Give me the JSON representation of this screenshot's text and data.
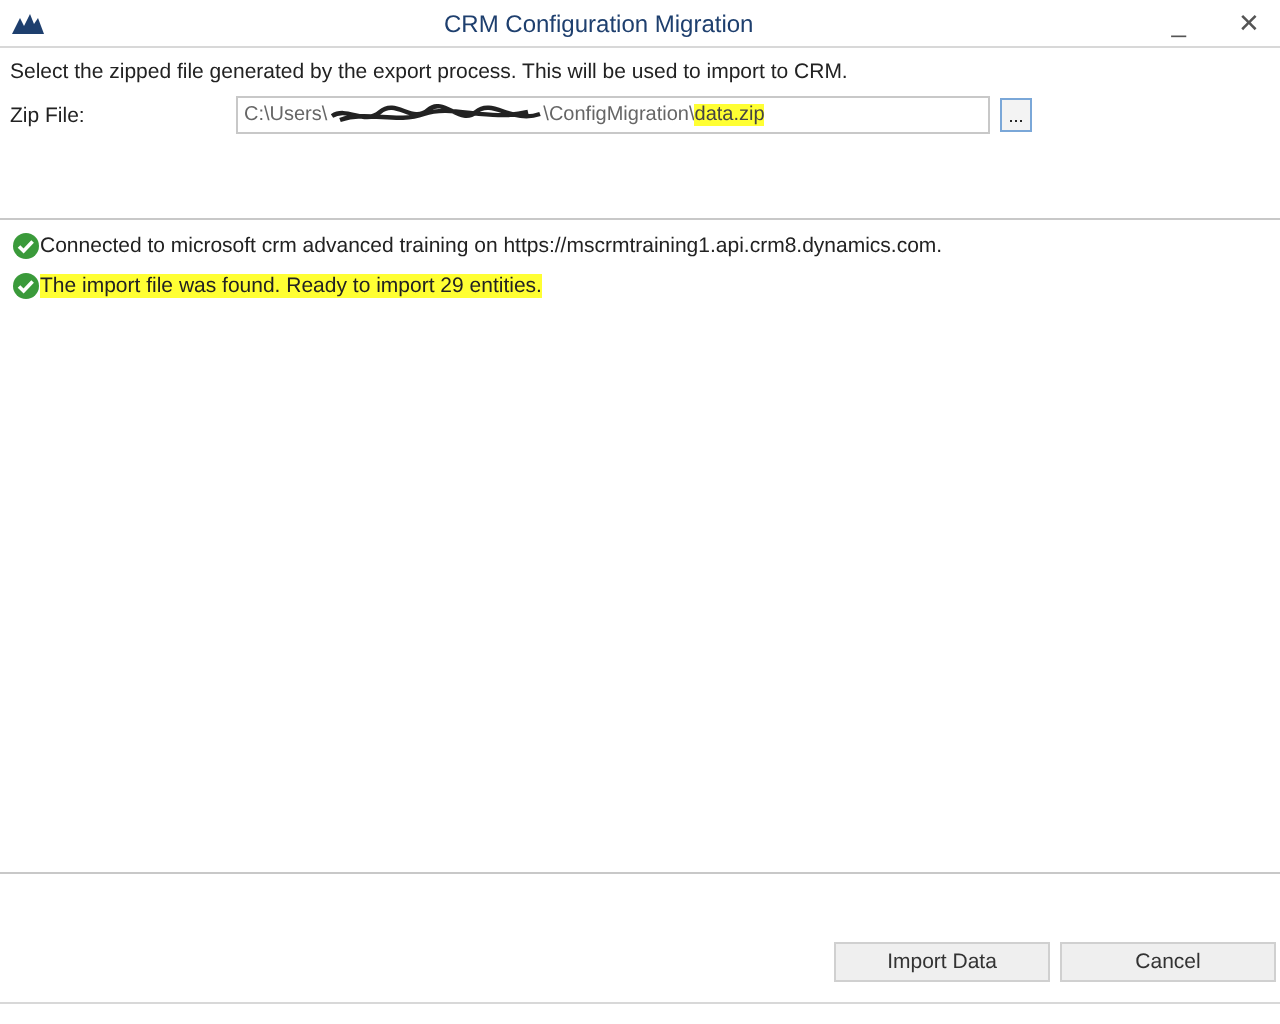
{
  "window": {
    "title": "CRM Configuration Migration",
    "controls": [
      "_",
      "✕"
    ]
  },
  "instruction": "Select the zipped file generated by the export process. This will be used to import to CRM.",
  "zip_file": {
    "label": "Zip File:",
    "path_start": "C:\\Users\\",
    "path_middle": "\\ConfigMigration\\",
    "file_name": "data.zip",
    "file_highlighted": true,
    "browse": "..."
  },
  "messages": [
    {
      "text": "Connected to microsoft crm advanced training on https://mscrmtraining1.api.crm8.dynamics.com.",
      "highlighted": false
    },
    {
      "text": "The import file was found. Ready to import 29 entities.",
      "highlighted": true
    }
  ],
  "buttons": [
    "Import Data",
    "Cancel"
  ]
}
